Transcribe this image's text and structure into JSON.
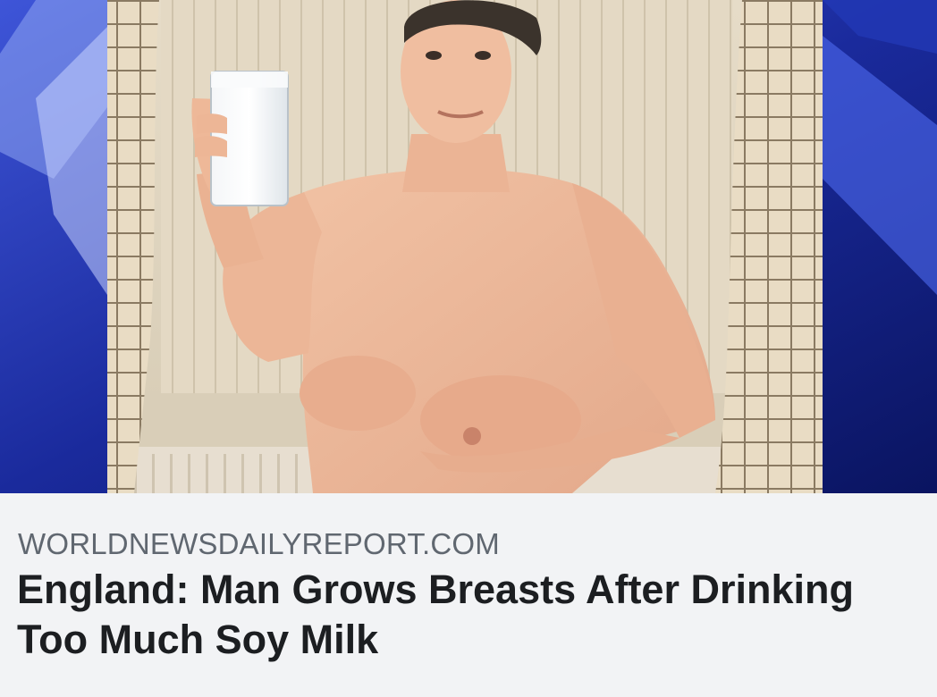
{
  "link_preview": {
    "image_alt": "Shirtless man holding a glass of milk in front of a curtained window",
    "domain": "WORLDNEWSDAILYREPORT.COM",
    "headline": "England: Man Grows Breasts After Drinking Too Much Soy Milk"
  },
  "colors": {
    "caption_background": "#f2f3f5",
    "domain_text": "#606770",
    "headline_text": "#1c1e21",
    "backdrop_blue": "#1a2a9c"
  }
}
